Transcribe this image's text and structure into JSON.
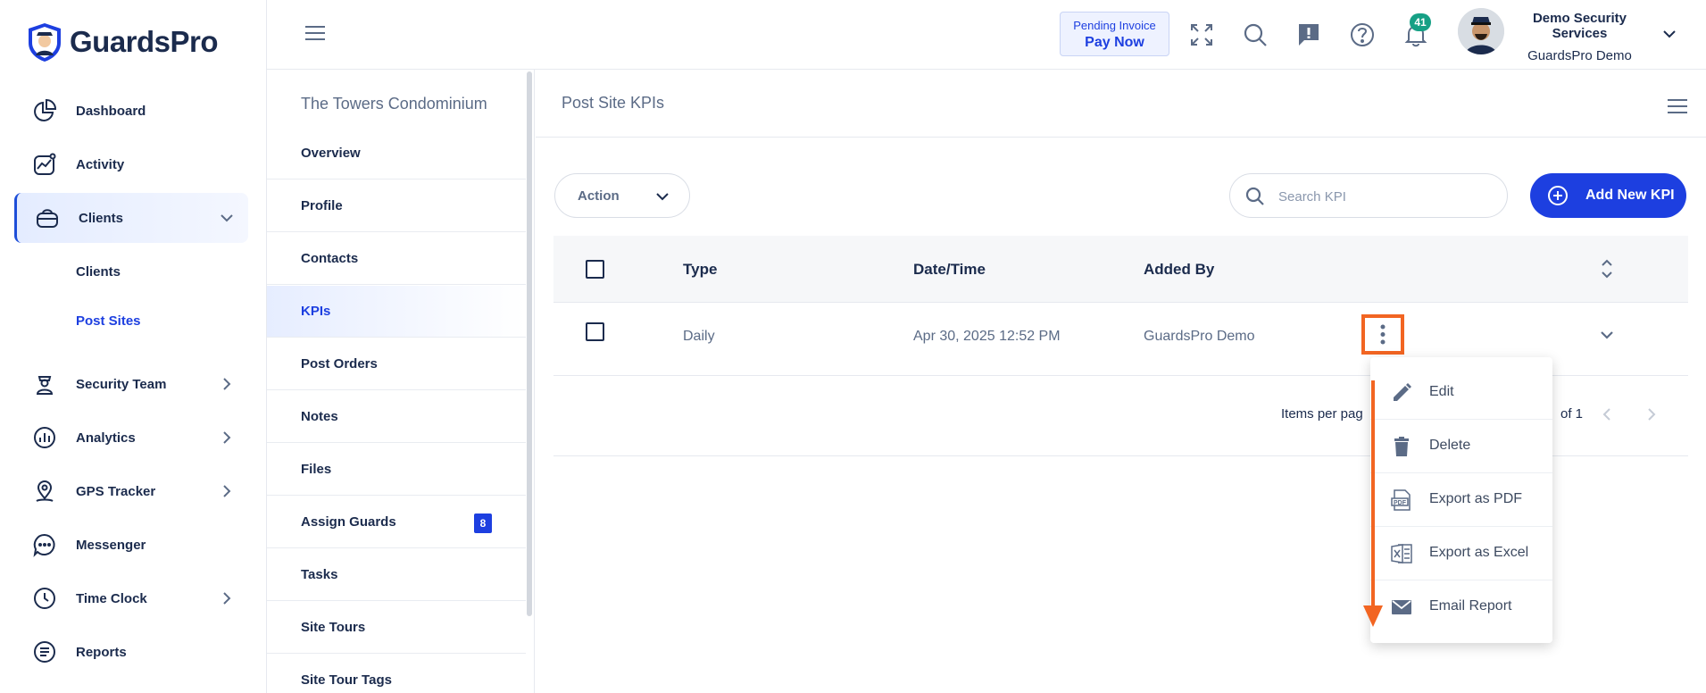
{
  "brand": {
    "name": "GuardsPro"
  },
  "sidebar": {
    "items": [
      {
        "label": "Dashboard",
        "icon": "pie-chart-icon",
        "has_chevron": false
      },
      {
        "label": "Activity",
        "icon": "activity-icon",
        "has_chevron": false
      },
      {
        "label": "Clients",
        "icon": "briefcase-icon",
        "has_chevron": true,
        "expanded": true
      },
      {
        "label": "Security Team",
        "icon": "guard-icon",
        "has_chevron": true
      },
      {
        "label": "Analytics",
        "icon": "analytics-icon",
        "has_chevron": true
      },
      {
        "label": "GPS Tracker",
        "icon": "map-pin-icon",
        "has_chevron": true
      },
      {
        "label": "Messenger",
        "icon": "chat-icon",
        "has_chevron": false
      },
      {
        "label": "Time Clock",
        "icon": "clock-icon",
        "has_chevron": true
      },
      {
        "label": "Reports",
        "icon": "reports-icon",
        "has_chevron": false
      }
    ],
    "clients_sub": [
      {
        "label": "Clients"
      },
      {
        "label": "Post Sites",
        "selected": true
      }
    ]
  },
  "header": {
    "pending_invoice": "Pending Invoice",
    "pay_now": "Pay Now",
    "notifications_count": "41",
    "company_name": "Demo Security Services",
    "user_name": "GuardsPro Demo"
  },
  "site_nav": {
    "title": "The Towers Condominium",
    "items": [
      {
        "label": "Overview"
      },
      {
        "label": "Profile"
      },
      {
        "label": "Contacts"
      },
      {
        "label": "KPIs",
        "active": true
      },
      {
        "label": "Post Orders"
      },
      {
        "label": "Notes"
      },
      {
        "label": "Files"
      },
      {
        "label": "Assign Guards",
        "badge": "8"
      },
      {
        "label": "Tasks"
      },
      {
        "label": "Site Tours"
      },
      {
        "label": "Site Tour Tags"
      }
    ]
  },
  "main": {
    "title": "Post Site KPIs",
    "action_label": "Action",
    "search_placeholder": "Search KPI",
    "add_button": "Add New KPI",
    "columns": {
      "type": "Type",
      "datetime": "Date/Time",
      "added_by": "Added By"
    },
    "rows": [
      {
        "type": "Daily",
        "datetime": "Apr 30, 2025 12:52 PM",
        "added_by": "GuardsPro Demo"
      }
    ],
    "pager": {
      "items_per_page": "Items per pag",
      "range": "of 1"
    }
  },
  "row_menu": {
    "items": [
      {
        "label": "Edit",
        "icon": "pencil-icon"
      },
      {
        "label": "Delete",
        "icon": "trash-icon"
      },
      {
        "label": "Export as PDF",
        "icon": "pdf-file-icon"
      },
      {
        "label": "Export as Excel",
        "icon": "excel-file-icon"
      },
      {
        "label": "Email Report",
        "icon": "envelope-icon"
      }
    ]
  },
  "colors": {
    "primary": "#1d3fe0",
    "accent_orange": "#f26522",
    "navy": "#1b2b4d",
    "badge_green": "#16a085"
  }
}
